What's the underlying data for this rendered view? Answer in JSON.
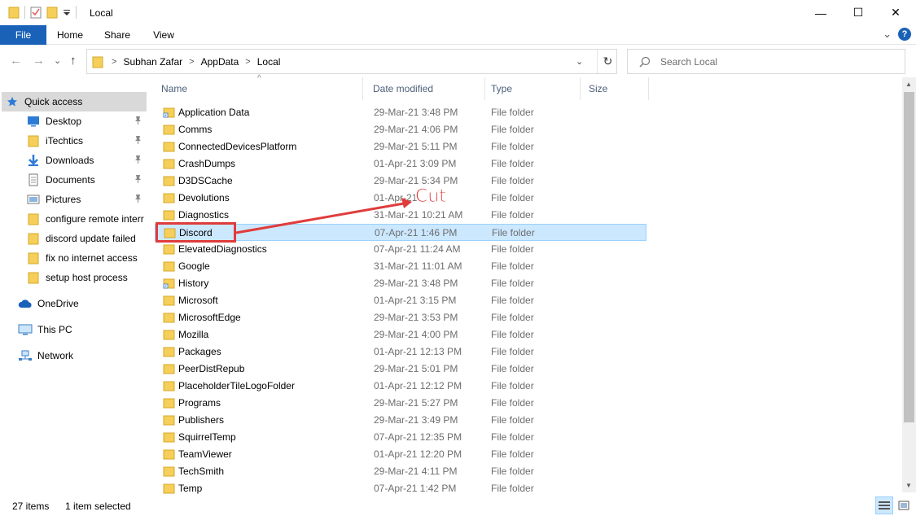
{
  "window": {
    "title": "Local",
    "minimize_glyph": "—",
    "maximize_glyph": "☐",
    "close_glyph": "✕"
  },
  "ribbon": {
    "tabs": [
      {
        "label": "File"
      },
      {
        "label": "Home"
      },
      {
        "label": "Share"
      },
      {
        "label": "View"
      }
    ],
    "help_glyph": "?",
    "expand_glyph": "⌄"
  },
  "address": {
    "back_glyph": "←",
    "forward_glyph": "→",
    "recent_glyph": "⌄",
    "up_glyph": "↑",
    "breadcrumbs": [
      "Subhan Zafar",
      "AppData",
      "Local"
    ],
    "separator": ">",
    "dropdown_glyph": "⌄",
    "refresh_glyph": "↻"
  },
  "search": {
    "placeholder": "Search Local"
  },
  "nav": {
    "quick_access": "Quick access",
    "items": [
      {
        "label": "Desktop",
        "icon": "desktop-icon",
        "pinned": true
      },
      {
        "label": "iTechtics",
        "icon": "folder-icon",
        "pinned": true
      },
      {
        "label": "Downloads",
        "icon": "download-icon",
        "pinned": true
      },
      {
        "label": "Documents",
        "icon": "documents-icon",
        "pinned": true
      },
      {
        "label": "Pictures",
        "icon": "pictures-icon",
        "pinned": true
      },
      {
        "label": "configure remote interr",
        "icon": "folder-icon",
        "pinned": false
      },
      {
        "label": "discord update failed",
        "icon": "folder-icon",
        "pinned": false
      },
      {
        "label": "fix no internet access",
        "icon": "folder-icon",
        "pinned": false
      },
      {
        "label": "setup host process",
        "icon": "folder-icon",
        "pinned": false
      }
    ],
    "onedrive": "OneDrive",
    "this_pc": "This PC",
    "network": "Network"
  },
  "columns": {
    "name": "Name",
    "date": "Date modified",
    "type": "Type",
    "size": "Size",
    "sort_glyph": "^"
  },
  "files": [
    {
      "name": "Application Data",
      "date": "29-Mar-21 3:48 PM",
      "type": "File folder",
      "shortcut": true
    },
    {
      "name": "Comms",
      "date": "29-Mar-21 4:06 PM",
      "type": "File folder"
    },
    {
      "name": "ConnectedDevicesPlatform",
      "date": "29-Mar-21 5:11 PM",
      "type": "File folder"
    },
    {
      "name": "CrashDumps",
      "date": "01-Apr-21 3:09 PM",
      "type": "File folder"
    },
    {
      "name": "D3DSCache",
      "date": "29-Mar-21 5:34 PM",
      "type": "File folder"
    },
    {
      "name": "Devolutions",
      "date": "01-Apr-21",
      "type": "File folder"
    },
    {
      "name": "Diagnostics",
      "date": "31-Mar-21 10:21 AM",
      "type": "File folder"
    },
    {
      "name": "Discord",
      "date": "07-Apr-21 1:46 PM",
      "type": "File folder",
      "selected": true
    },
    {
      "name": "ElevatedDiagnostics",
      "date": "07-Apr-21 11:24 AM",
      "type": "File folder"
    },
    {
      "name": "Google",
      "date": "31-Mar-21 11:01 AM",
      "type": "File folder"
    },
    {
      "name": "History",
      "date": "29-Mar-21 3:48 PM",
      "type": "File folder",
      "shortcut": true
    },
    {
      "name": "Microsoft",
      "date": "01-Apr-21 3:15 PM",
      "type": "File folder"
    },
    {
      "name": "MicrosoftEdge",
      "date": "29-Mar-21 3:53 PM",
      "type": "File folder"
    },
    {
      "name": "Mozilla",
      "date": "29-Mar-21 4:00 PM",
      "type": "File folder"
    },
    {
      "name": "Packages",
      "date": "01-Apr-21 12:13 PM",
      "type": "File folder"
    },
    {
      "name": "PeerDistRepub",
      "date": "29-Mar-21 5:01 PM",
      "type": "File folder"
    },
    {
      "name": "PlaceholderTileLogoFolder",
      "date": "01-Apr-21 12:12 PM",
      "type": "File folder"
    },
    {
      "name": "Programs",
      "date": "29-Mar-21 5:27 PM",
      "type": "File folder"
    },
    {
      "name": "Publishers",
      "date": "29-Mar-21 3:49 PM",
      "type": "File folder"
    },
    {
      "name": "SquirrelTemp",
      "date": "07-Apr-21 12:35 PM",
      "type": "File folder"
    },
    {
      "name": "TeamViewer",
      "date": "01-Apr-21 12:20 PM",
      "type": "File folder"
    },
    {
      "name": "TechSmith",
      "date": "29-Mar-21 4:11 PM",
      "type": "File folder"
    },
    {
      "name": "Temp",
      "date": "07-Apr-21 1:42 PM",
      "type": "File folder"
    }
  ],
  "status": {
    "item_count": "27 items",
    "selection": "1 item selected"
  },
  "annotation": {
    "text": "Cut",
    "color": "#e03c3c"
  },
  "colors": {
    "accent": "#1a62b8",
    "selection_bg": "#cce8ff",
    "selection_border": "#99d1ff",
    "folder": "#f5cf5a"
  }
}
